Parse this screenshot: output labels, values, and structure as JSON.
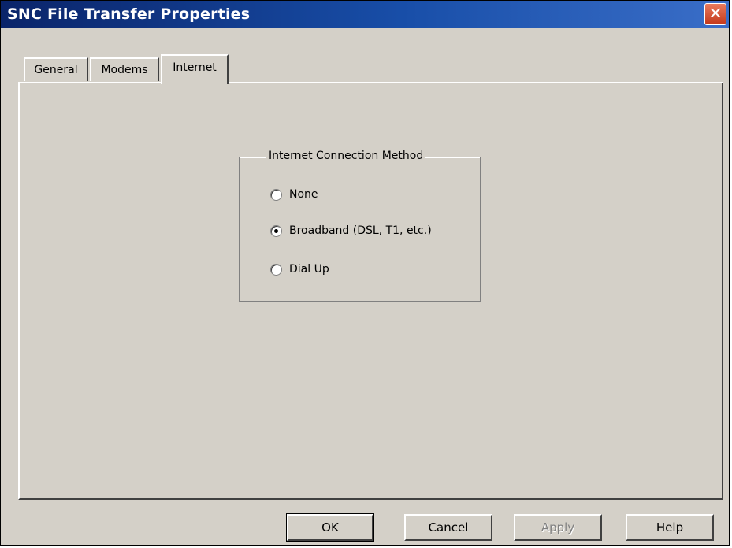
{
  "window": {
    "title": "SNC File Transfer Properties",
    "close_glyph": "✕"
  },
  "tabs": [
    {
      "label": "General",
      "selected": false
    },
    {
      "label": "Modems",
      "selected": false
    },
    {
      "label": "Internet",
      "selected": true
    }
  ],
  "internet_panel": {
    "group_title": "Internet Connection Method",
    "options": [
      {
        "label": "None",
        "selected": false
      },
      {
        "label": "Broadband (DSL, T1, etc.)",
        "selected": true
      },
      {
        "label": "Dial Up",
        "selected": false
      }
    ]
  },
  "buttons": {
    "ok": "OK",
    "cancel": "Cancel",
    "apply": "Apply",
    "help": "Help"
  },
  "colors": {
    "titlebar_start": "#0a246a",
    "titlebar_end": "#3a6ec8",
    "dialog_face": "#d4d0c8",
    "close_button": "#c4381a"
  }
}
